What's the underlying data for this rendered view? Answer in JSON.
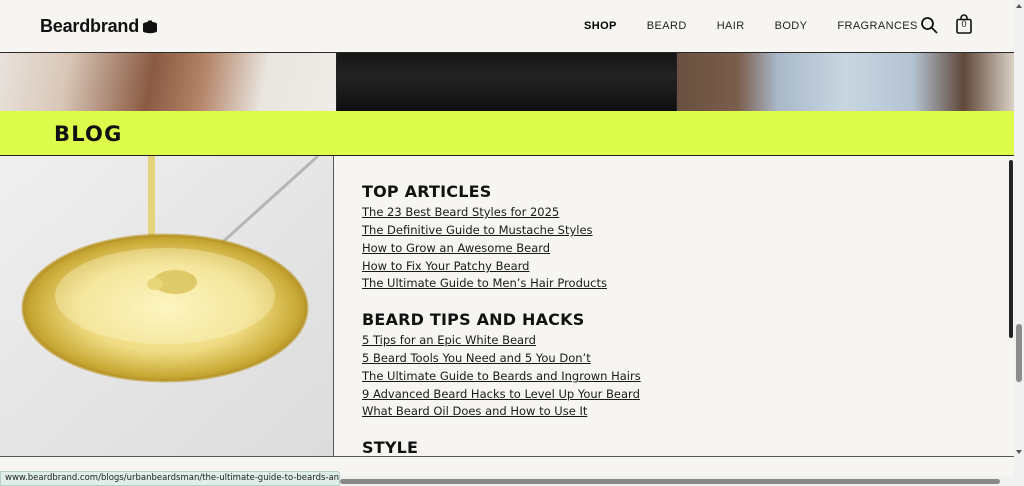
{
  "header": {
    "logo_text": "Beardbrand",
    "nav": [
      {
        "label": "SHOP",
        "active": true
      },
      {
        "label": "BEARD",
        "active": false
      },
      {
        "label": "HAIR",
        "active": false
      },
      {
        "label": "BODY",
        "active": false
      },
      {
        "label": "FRAGRANCES",
        "active": false
      }
    ],
    "cart_count": "0",
    "icons": {
      "search": "search-icon",
      "cart": "shopping-bag-icon"
    }
  },
  "blog": {
    "title": "BLOG"
  },
  "sections": [
    {
      "heading": "TOP ARTICLES",
      "links": [
        "The 23 Best Beard Styles for 2025",
        "The Definitive Guide to Mustache Styles",
        "How to Grow an Awesome Beard",
        "How to Fix Your Patchy Beard",
        "The Ultimate Guide to Men’s Hair Products"
      ]
    },
    {
      "heading": "BEARD TIPS AND HACKS",
      "links": [
        "5 Tips for an Epic White Beard",
        "5 Beard Tools You Need and 5 You Don’t",
        "The Ultimate Guide to Beards and Ingrown Hairs",
        "9 Advanced Beard Hacks to Level Up Your Beard",
        "What Beard Oil Does and How to Use It"
      ]
    },
    {
      "heading": "STYLE",
      "links": []
    }
  ],
  "status_bar": {
    "url": "www.beardbrand.com/blogs/urbanbeardsman/the-ultimate-guide-to-beards-and-ingrown-h..."
  },
  "colors": {
    "accent": "#dcfb4a",
    "background": "#f7f5f1",
    "text": "#111111"
  }
}
